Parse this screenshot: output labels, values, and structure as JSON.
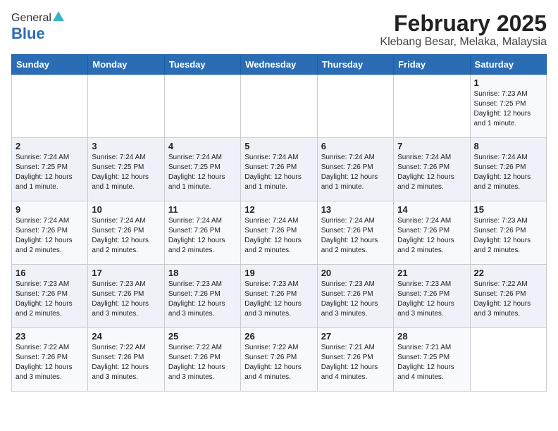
{
  "header": {
    "logo_general": "General",
    "logo_blue": "Blue",
    "title": "February 2025",
    "subtitle": "Klebang Besar, Melaka, Malaysia"
  },
  "days_of_week": [
    "Sunday",
    "Monday",
    "Tuesday",
    "Wednesday",
    "Thursday",
    "Friday",
    "Saturday"
  ],
  "weeks": [
    [
      {
        "day": "",
        "info": ""
      },
      {
        "day": "",
        "info": ""
      },
      {
        "day": "",
        "info": ""
      },
      {
        "day": "",
        "info": ""
      },
      {
        "day": "",
        "info": ""
      },
      {
        "day": "",
        "info": ""
      },
      {
        "day": "1",
        "info": "Sunrise: 7:23 AM\nSunset: 7:25 PM\nDaylight: 12 hours and 1 minute."
      }
    ],
    [
      {
        "day": "2",
        "info": "Sunrise: 7:24 AM\nSunset: 7:25 PM\nDaylight: 12 hours and 1 minute."
      },
      {
        "day": "3",
        "info": "Sunrise: 7:24 AM\nSunset: 7:25 PM\nDaylight: 12 hours and 1 minute."
      },
      {
        "day": "4",
        "info": "Sunrise: 7:24 AM\nSunset: 7:25 PM\nDaylight: 12 hours and 1 minute."
      },
      {
        "day": "5",
        "info": "Sunrise: 7:24 AM\nSunset: 7:26 PM\nDaylight: 12 hours and 1 minute."
      },
      {
        "day": "6",
        "info": "Sunrise: 7:24 AM\nSunset: 7:26 PM\nDaylight: 12 hours and 1 minute."
      },
      {
        "day": "7",
        "info": "Sunrise: 7:24 AM\nSunset: 7:26 PM\nDaylight: 12 hours and 2 minutes."
      },
      {
        "day": "8",
        "info": "Sunrise: 7:24 AM\nSunset: 7:26 PM\nDaylight: 12 hours and 2 minutes."
      }
    ],
    [
      {
        "day": "9",
        "info": "Sunrise: 7:24 AM\nSunset: 7:26 PM\nDaylight: 12 hours and 2 minutes."
      },
      {
        "day": "10",
        "info": "Sunrise: 7:24 AM\nSunset: 7:26 PM\nDaylight: 12 hours and 2 minutes."
      },
      {
        "day": "11",
        "info": "Sunrise: 7:24 AM\nSunset: 7:26 PM\nDaylight: 12 hours and 2 minutes."
      },
      {
        "day": "12",
        "info": "Sunrise: 7:24 AM\nSunset: 7:26 PM\nDaylight: 12 hours and 2 minutes."
      },
      {
        "day": "13",
        "info": "Sunrise: 7:24 AM\nSunset: 7:26 PM\nDaylight: 12 hours and 2 minutes."
      },
      {
        "day": "14",
        "info": "Sunrise: 7:24 AM\nSunset: 7:26 PM\nDaylight: 12 hours and 2 minutes."
      },
      {
        "day": "15",
        "info": "Sunrise: 7:23 AM\nSunset: 7:26 PM\nDaylight: 12 hours and 2 minutes."
      }
    ],
    [
      {
        "day": "16",
        "info": "Sunrise: 7:23 AM\nSunset: 7:26 PM\nDaylight: 12 hours and 2 minutes."
      },
      {
        "day": "17",
        "info": "Sunrise: 7:23 AM\nSunset: 7:26 PM\nDaylight: 12 hours and 3 minutes."
      },
      {
        "day": "18",
        "info": "Sunrise: 7:23 AM\nSunset: 7:26 PM\nDaylight: 12 hours and 3 minutes."
      },
      {
        "day": "19",
        "info": "Sunrise: 7:23 AM\nSunset: 7:26 PM\nDaylight: 12 hours and 3 minutes."
      },
      {
        "day": "20",
        "info": "Sunrise: 7:23 AM\nSunset: 7:26 PM\nDaylight: 12 hours and 3 minutes."
      },
      {
        "day": "21",
        "info": "Sunrise: 7:23 AM\nSunset: 7:26 PM\nDaylight: 12 hours and 3 minutes."
      },
      {
        "day": "22",
        "info": "Sunrise: 7:22 AM\nSunset: 7:26 PM\nDaylight: 12 hours and 3 minutes."
      }
    ],
    [
      {
        "day": "23",
        "info": "Sunrise: 7:22 AM\nSunset: 7:26 PM\nDaylight: 12 hours and 3 minutes."
      },
      {
        "day": "24",
        "info": "Sunrise: 7:22 AM\nSunset: 7:26 PM\nDaylight: 12 hours and 3 minutes."
      },
      {
        "day": "25",
        "info": "Sunrise: 7:22 AM\nSunset: 7:26 PM\nDaylight: 12 hours and 3 minutes."
      },
      {
        "day": "26",
        "info": "Sunrise: 7:22 AM\nSunset: 7:26 PM\nDaylight: 12 hours and 4 minutes."
      },
      {
        "day": "27",
        "info": "Sunrise: 7:21 AM\nSunset: 7:26 PM\nDaylight: 12 hours and 4 minutes."
      },
      {
        "day": "28",
        "info": "Sunrise: 7:21 AM\nSunset: 7:25 PM\nDaylight: 12 hours and 4 minutes."
      },
      {
        "day": "",
        "info": ""
      }
    ]
  ]
}
